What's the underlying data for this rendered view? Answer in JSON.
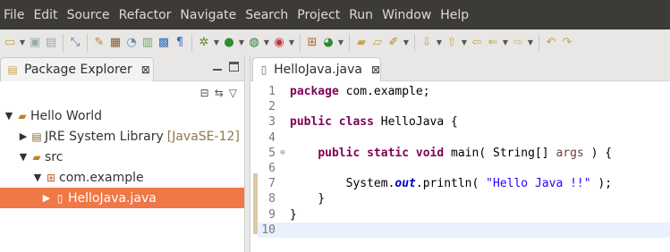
{
  "menu": [
    "File",
    "Edit",
    "Source",
    "Refactor",
    "Navigate",
    "Search",
    "Project",
    "Run",
    "Window",
    "Help"
  ],
  "toolbar_icons": [
    "new-icon",
    "save-icon",
    "save-all-icon",
    "skip-breakpoints-icon",
    "new-java-project-icon",
    "new-package-icon",
    "new-class-icon",
    "open-type-icon",
    "show-whitespace-icon",
    "debug-icon",
    "run-icon",
    "coverage-icon",
    "external-tools-icon",
    "new-java-class-icon",
    "open-task-icon",
    "search-icon",
    "open-perspective-icon",
    "next-annotation-icon",
    "previous-annotation-icon",
    "back-icon",
    "forward-icon",
    "last-edit-icon",
    "toggle-breadcrumb-icon"
  ],
  "package_explorer": {
    "title": "Package Explorer",
    "tree": [
      {
        "label": "Hello World",
        "extra": "",
        "level": 0,
        "expanded": true,
        "icon": "project-icon"
      },
      {
        "label": "JRE System Library",
        "extra": "[JavaSE-12]",
        "level": 1,
        "expanded": false,
        "icon": "library-icon"
      },
      {
        "label": "src",
        "extra": "",
        "level": 1,
        "expanded": true,
        "icon": "source-folder-icon"
      },
      {
        "label": "com.example",
        "extra": "",
        "level": 2,
        "expanded": true,
        "icon": "package-icon"
      },
      {
        "label": "HelloJava.java",
        "extra": "",
        "level": 3,
        "expanded": false,
        "icon": "java-file-icon",
        "selected": true
      }
    ]
  },
  "editor": {
    "tab_title": "HelloJava.java",
    "lines": [
      {
        "n": "1",
        "text": "package com.example;"
      },
      {
        "n": "2",
        "text": ""
      },
      {
        "n": "3",
        "text": "public class HelloJava {"
      },
      {
        "n": "4",
        "text": ""
      },
      {
        "n": "5",
        "text": "    public static void main( String[] args ) {"
      },
      {
        "n": "6",
        "text": ""
      },
      {
        "n": "7",
        "text": "        System.out.println( \"Hello Java !!\" );"
      },
      {
        "n": "8",
        "text": "    }"
      },
      {
        "n": "9",
        "text": "}"
      },
      {
        "n": "10",
        "text": ""
      }
    ],
    "current_line": "10"
  }
}
